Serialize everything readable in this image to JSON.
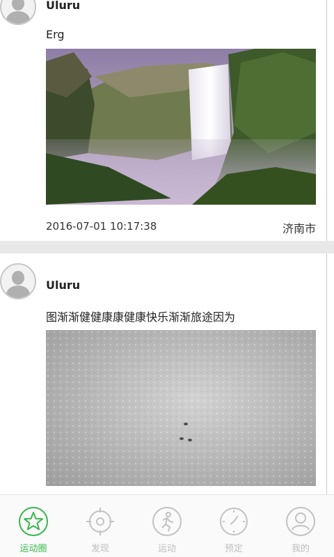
{
  "posts": [
    {
      "username": "Uluru",
      "text": "Erg",
      "time": "2016-07-01 10:17:38",
      "location": "济南市",
      "image": "waterfall photo"
    },
    {
      "username": "Uluru",
      "text": "图渐渐健健康康健康快乐渐渐旅途因为",
      "image": "grey textured surface photo"
    }
  ],
  "tabbar": {
    "accent_color": "#36b84a",
    "inactive_color": "#bdbdbd",
    "tabs": [
      {
        "label": "运动圈",
        "icon": "star-icon",
        "active": true
      },
      {
        "label": "发现",
        "icon": "compass-icon",
        "active": false
      },
      {
        "label": "运动",
        "icon": "runner-icon",
        "active": false
      },
      {
        "label": "预定",
        "icon": "clock-icon",
        "active": false
      },
      {
        "label": "我的",
        "icon": "user-icon",
        "active": false
      }
    ]
  }
}
